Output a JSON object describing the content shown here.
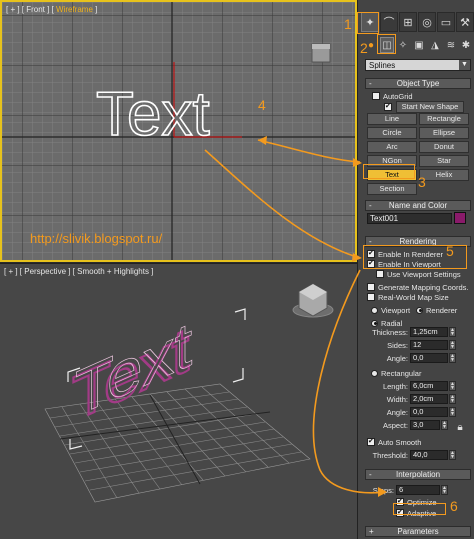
{
  "viewports": {
    "front": {
      "label_prefix": "[ + ] [ Front ] [ ",
      "label_mode": "Wireframe",
      "label_suffix": " ]",
      "text_object": "Text"
    },
    "perspective": {
      "label": "[ + ] [ Perspective ] [ Smooth + Highlights ]"
    }
  },
  "annotations": {
    "url": "http://slivik.blogspot.ru/",
    "n1": "1",
    "n2": "2",
    "n3": "3",
    "n4": "4",
    "n5": "5",
    "n6": "6",
    "color": "#f39a1e"
  },
  "panel": {
    "tabs": [
      "create-icon",
      "modify-icon",
      "hierarchy-icon",
      "motion-icon",
      "display-icon",
      "utilities-icon"
    ],
    "subtabs": [
      "geometry-icon",
      "shapes-icon",
      "lights-icon",
      "cameras-icon",
      "helpers-icon",
      "spacewarps-icon",
      "systems-icon"
    ],
    "category_dropdown": "Splines",
    "object_type": {
      "title": "Object Type",
      "autogrid": "AutoGrid",
      "start_new_shape": "Start New Shape",
      "buttons": [
        "Line",
        "Rectangle",
        "Circle",
        "Ellipse",
        "Arc",
        "Donut",
        "NGon",
        "Star",
        "Text",
        "Helix",
        "Section"
      ],
      "active": "Text"
    },
    "name_and_color": {
      "title": "Name and Color",
      "name_value": "Text001",
      "color": "#8a1a6a"
    },
    "rendering": {
      "title": "Rendering",
      "enable_in_renderer": "Enable In Renderer",
      "enable_in_viewport": "Enable In Viewport",
      "use_viewport_settings": "Use Viewport Settings",
      "generate_mapping": "Generate Mapping Coords.",
      "real_world_map_size": "Real-World Map Size",
      "viewport_radio": "Viewport",
      "renderer_radio": "Renderer",
      "radial": "Radial",
      "thickness_label": "Thickness:",
      "thickness_value": "1,25cm",
      "sides_label": "Sides:",
      "sides_value": "12",
      "angle_label": "Angle:",
      "angle_value": "0,0",
      "rectangular": "Rectangular",
      "length_label": "Length:",
      "length_value": "6,0cm",
      "width_label": "Width:",
      "width_value": "2,0cm",
      "angle2_label": "Angle:",
      "angle2_value": "0,0",
      "aspect_label": "Aspect:",
      "aspect_value": "3,0",
      "auto_smooth": "Auto Smooth",
      "threshold_label": "Threshold:",
      "threshold_value": "40,0"
    },
    "interpolation": {
      "title": "Interpolation",
      "steps_label": "Steps:",
      "steps_value": "6",
      "optimize": "Optimize",
      "adaptive": "Adaptive"
    },
    "parameters": {
      "title": "Parameters"
    },
    "rollout_open": "-",
    "rollout_closed": "+"
  }
}
